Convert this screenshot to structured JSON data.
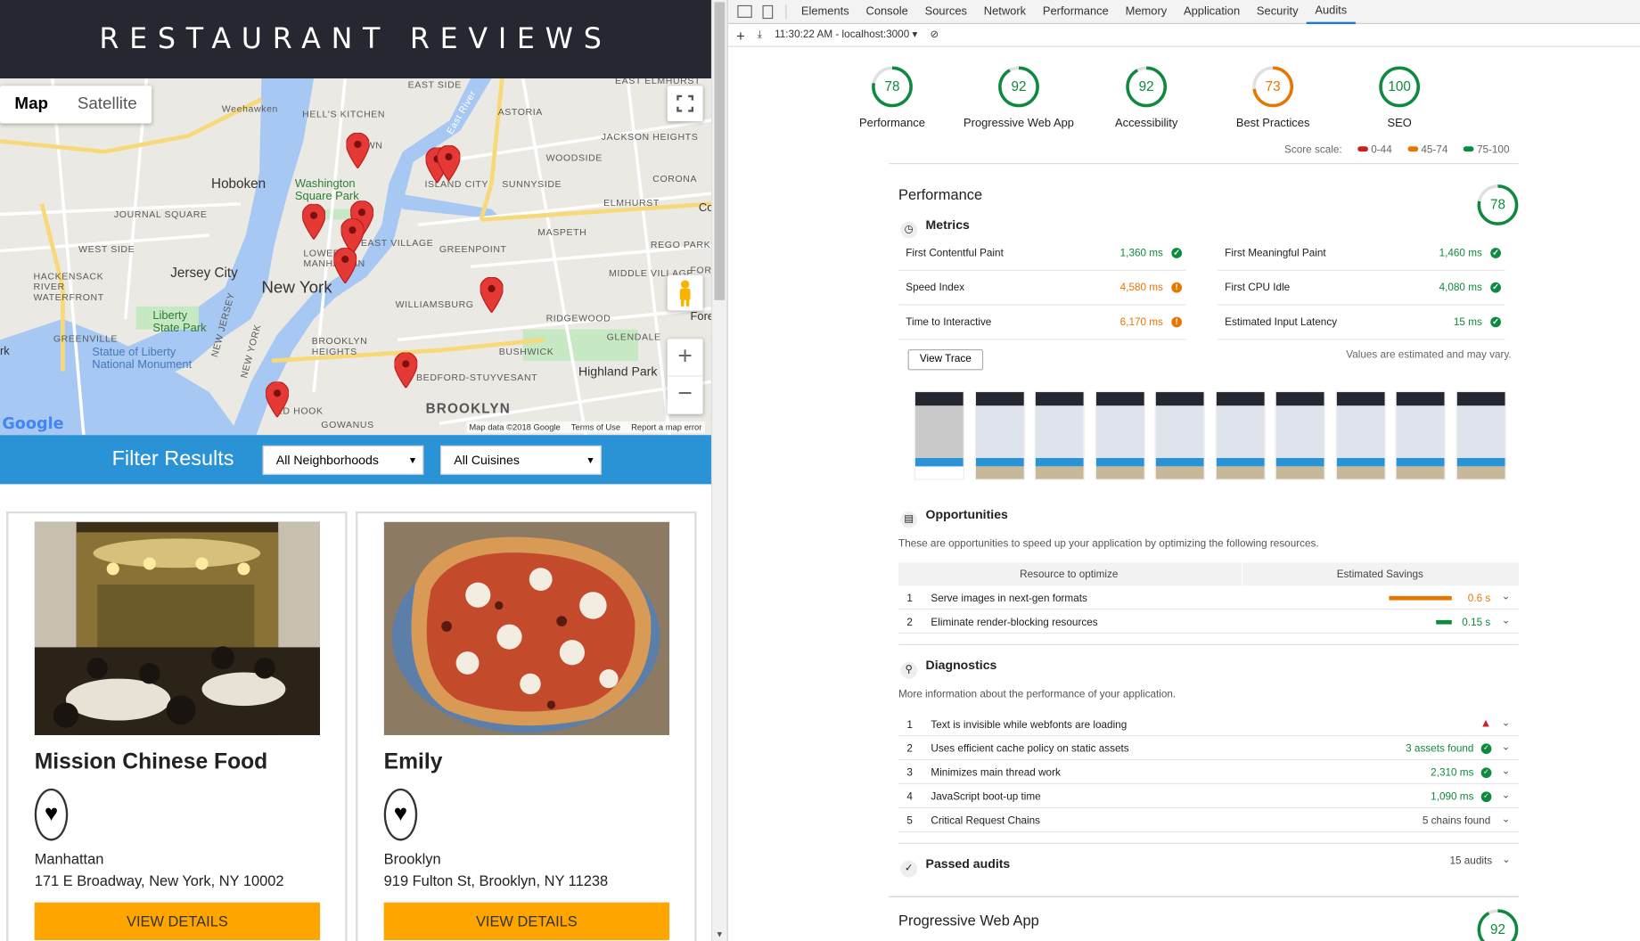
{
  "page": {
    "title": "RESTAURANT REVIEWS"
  },
  "map": {
    "type_map": "Map",
    "type_satellite": "Satellite",
    "labels": {
      "weehawken": "Weehawken",
      "hells_kitchen": "HELL'S KITCHEN",
      "east_side": "EAST SIDE",
      "east_elmhurst": "EAST ELMHURST",
      "astoria": "ASTORIA",
      "jackson_heights": "JACKSON HEIGHTS",
      "hoboken": "Hoboken",
      "washington_square": "Washington Square Park",
      "island_city": "ISLAND CITY",
      "woodside": "WOODSIDE",
      "sunnyside": "SUNNYSIDE",
      "corona": "CORONA",
      "journal_square": "JOURNAL SQUARE",
      "elmhurst": "ELMHURST",
      "west_side": "WEST SIDE",
      "maspeth": "MASPETH",
      "rego_park": "REGO PARK",
      "jersey_city": "Jersey City",
      "east_village": "EAST VILLAGE",
      "greenpoint": "GREENPOINT",
      "lower_manhattan": "LOWER MANHATTAN",
      "hackensack": "HACKENSACK RIVER WATERFRONT",
      "new_york": "New York",
      "middle_village": "MIDDLE VILLAGE",
      "forest": "FORE",
      "williamsburg": "WILLIAMSBURG",
      "ridgewood": "RIDGEWOOD",
      "liberty_park": "Liberty State Park",
      "greenville": "GREENVILLE",
      "glendale": "GLENDALE",
      "statue_of_liberty": "Statue of Liberty National Monument",
      "brooklyn_heights": "BROOKLYN HEIGHTS",
      "bushwick": "BUSHWICK",
      "highland_park": "Highland Park",
      "new_jersey": "NEW JERSEY",
      "new_york_state": "NEW YORK",
      "bedford": "BEDFORD-STUYVESANT",
      "red_hook": "ED HOOK",
      "brooklyn": "BROOKLYN",
      "gowanus": "GOWANUS",
      "town": "WN",
      "east_river": "East River",
      "rk": "rk",
      "fore2": "Fore",
      "co": "Co"
    },
    "copyright": "Map data ©2018 Google",
    "terms": "Terms of Use",
    "report": "Report a map error",
    "google": "Google"
  },
  "filter": {
    "label": "Filter Results",
    "neighborhood": "All Neighborhoods",
    "cuisine": "All Cuisines"
  },
  "restaurants": [
    {
      "name": "Mission Chinese Food",
      "neighborhood": "Manhattan",
      "address": "171 E Broadway, New York, NY 10002",
      "button": "VIEW DETAILS"
    },
    {
      "name": "Emily",
      "neighborhood": "Brooklyn",
      "address": "919 Fulton St, Brooklyn, NY 11238",
      "button": "VIEW DETAILS"
    }
  ],
  "devtools": {
    "tabs": [
      "Elements",
      "Console",
      "Sources",
      "Network",
      "Performance",
      "Memory",
      "Application",
      "Security",
      "Audits"
    ],
    "active_tab": "Audits",
    "session": "11:30:22 AM - localhost:3000 ▾"
  },
  "audits": {
    "gauges": [
      {
        "label": "Performance",
        "score": "78",
        "color": "#0d8a3e"
      },
      {
        "label": "Progressive Web App",
        "score": "92",
        "color": "#0d8a3e"
      },
      {
        "label": "Accessibility",
        "score": "92",
        "color": "#0d8a3e"
      },
      {
        "label": "Best Practices",
        "score": "73",
        "color": "#e67700"
      },
      {
        "label": "SEO",
        "score": "100",
        "color": "#0d8a3e"
      }
    ],
    "scale_label": "Score scale:",
    "scale": [
      {
        "label": "0-44",
        "color": "#c7221f"
      },
      {
        "label": "45-74",
        "color": "#e67700"
      },
      {
        "label": "75-100",
        "color": "#0d8a3e"
      }
    ],
    "performance": {
      "title": "Performance",
      "score": "78",
      "metrics_title": "Metrics",
      "metrics": [
        {
          "name": "First Contentful Paint",
          "value": "1,360 ms",
          "status": "pass"
        },
        {
          "name": "First Meaningful Paint",
          "value": "1,460 ms",
          "status": "pass"
        },
        {
          "name": "Speed Index",
          "value": "4,580 ms",
          "status": "avg"
        },
        {
          "name": "First CPU Idle",
          "value": "4,080 ms",
          "status": "pass"
        },
        {
          "name": "Time to Interactive",
          "value": "6,170 ms",
          "status": "avg"
        },
        {
          "name": "Estimated Input Latency",
          "value": "15 ms",
          "status": "pass"
        }
      ],
      "view_trace": "View Trace",
      "estimate_note": "Values are estimated and may vary.",
      "opportunities_title": "Opportunities",
      "opportunities_desc": "These are opportunities to speed up your application by optimizing the following resources.",
      "col_resource": "Resource to optimize",
      "col_savings": "Estimated Savings",
      "opportunities": [
        {
          "n": "1",
          "desc": "Serve images in next-gen formats",
          "value": "0.6 s",
          "color": "#e67700",
          "fraction": 1.0
        },
        {
          "n": "2",
          "desc": "Eliminate render-blocking resources",
          "value": "0.15 s",
          "color": "#0d8a3e",
          "fraction": 0.25
        }
      ],
      "diagnostics_title": "Diagnostics",
      "diagnostics_desc": "More information about the performance of your application.",
      "diagnostics": [
        {
          "n": "1",
          "desc": "Text is invisible while webfonts are loading",
          "value": "",
          "status": "fail"
        },
        {
          "n": "2",
          "desc": "Uses efficient cache policy on static assets",
          "value": "3 assets found",
          "status": "pass"
        },
        {
          "n": "3",
          "desc": "Minimizes main thread work",
          "value": "2,310 ms",
          "status": "pass"
        },
        {
          "n": "4",
          "desc": "JavaScript boot-up time",
          "value": "1,090 ms",
          "status": "pass"
        },
        {
          "n": "5",
          "desc": "Critical Request Chains",
          "value": "5 chains found",
          "status": "info"
        }
      ],
      "passed_title": "Passed audits",
      "passed_count": "15 audits"
    },
    "pwa": {
      "title": "Progressive Web App",
      "score": "92"
    }
  }
}
